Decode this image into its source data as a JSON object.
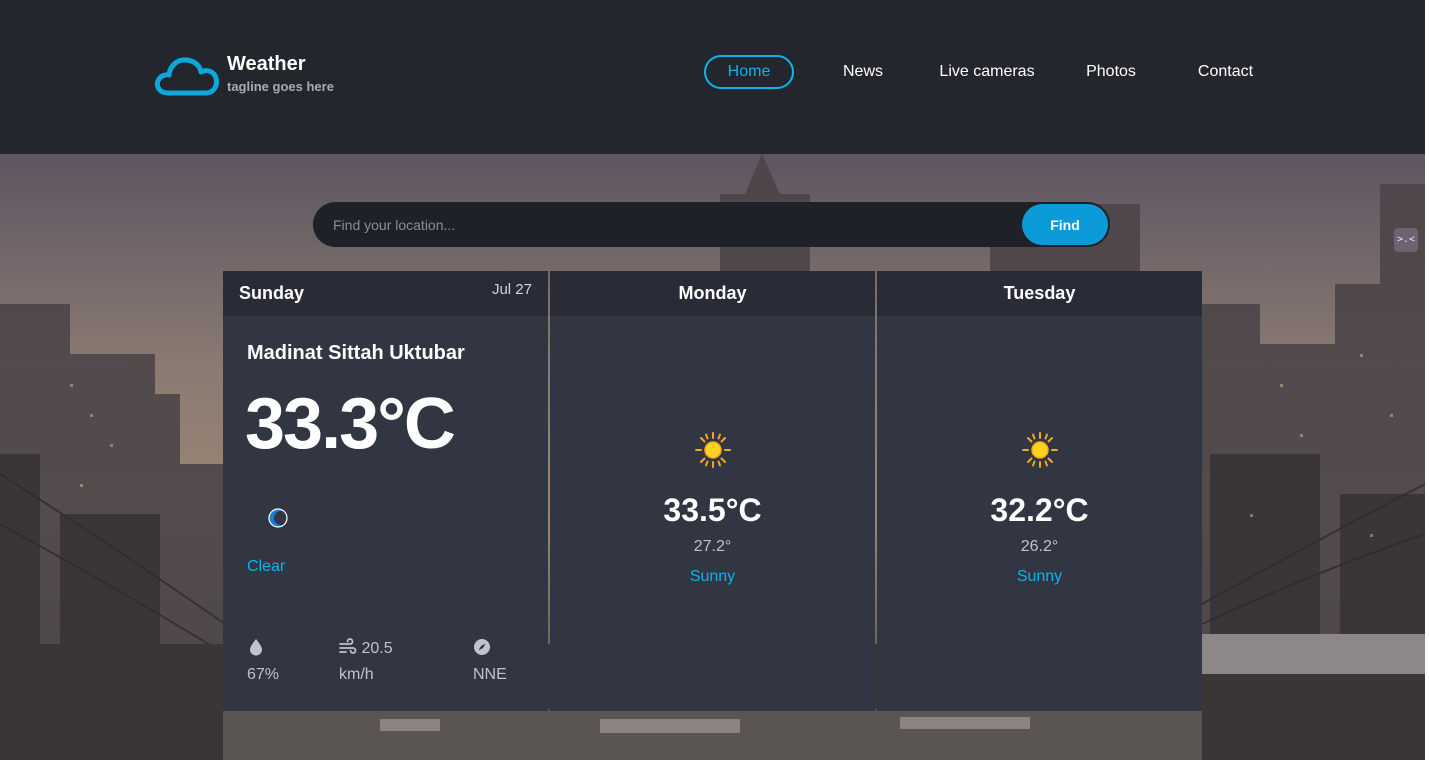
{
  "brand": {
    "name": "Weather",
    "tagline": "tagline goes here",
    "accent": "#0db4e9"
  },
  "nav": {
    "items": [
      {
        "label": "Home",
        "active": true
      },
      {
        "label": "News",
        "active": false
      },
      {
        "label": "Live cameras",
        "active": false
      },
      {
        "label": "Photos",
        "active": false
      },
      {
        "label": "Contact",
        "active": false
      }
    ]
  },
  "search": {
    "placeholder": "Find your location...",
    "value": "",
    "button_label": "Find"
  },
  "today": {
    "day": "Sunday",
    "date": "Jul 27",
    "location": "Madinat Sittah Uktubar",
    "temperature": "33.3°C",
    "icon": "moon-icon",
    "condition": "Clear",
    "humidity": "67%",
    "wind_value": "20.5",
    "wind_unit": "km/h",
    "wind_direction": "NNE"
  },
  "forecast": [
    {
      "day": "Monday",
      "icon": "sun-icon",
      "max": "33.5°C",
      "min": "27.2°",
      "condition": "Sunny"
    },
    {
      "day": "Tuesday",
      "icon": "sun-icon",
      "max": "32.2°C",
      "min": "26.2°",
      "condition": "Sunny"
    }
  ],
  "side_handle": {
    "label": ">.<"
  }
}
